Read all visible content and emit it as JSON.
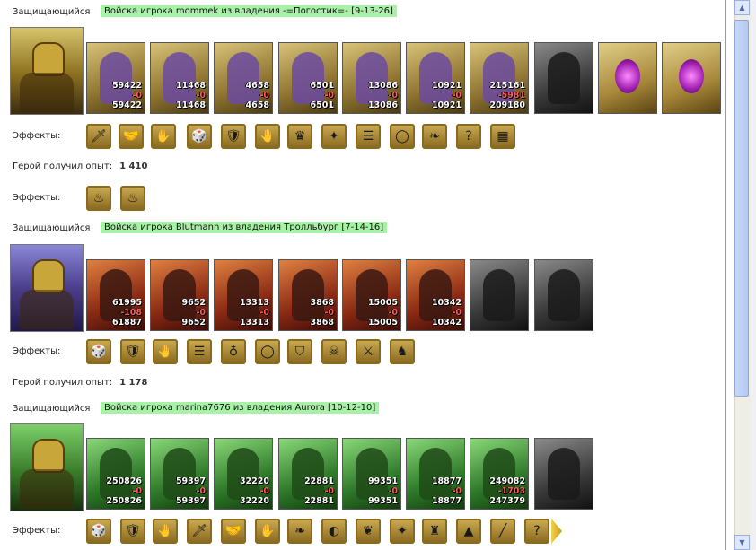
{
  "common": {
    "defender_label": "Защищающийся",
    "effects_label": "Эффекты:",
    "exp_label": "Герой получил опыт:"
  },
  "armies": [
    {
      "title": "Войска игрока mommek из владения -=Погостик=- [9-13-26]",
      "hero_style": "gold",
      "units": [
        {
          "bg": "gold",
          "count": "59422",
          "loss": "-0",
          "remain": "59422"
        },
        {
          "bg": "gold",
          "count": "11468",
          "loss": "-0",
          "remain": "11468"
        },
        {
          "bg": "gold",
          "count": "4658",
          "loss": "-0",
          "remain": "4658"
        },
        {
          "bg": "gold",
          "count": "6501",
          "loss": "-0",
          "remain": "6501"
        },
        {
          "bg": "gold",
          "count": "13086",
          "loss": "-0",
          "remain": "13086"
        },
        {
          "bg": "gold",
          "count": "10921",
          "loss": "-0",
          "remain": "10921"
        },
        {
          "bg": "gold",
          "count": "215161",
          "loss": "-5981",
          "remain": "209180"
        },
        {
          "bg": "gray",
          "count": "",
          "loss": "",
          "remain": ""
        },
        {
          "bg": "gold-orb",
          "count": "",
          "loss": "",
          "remain": ""
        },
        {
          "bg": "gold-orb",
          "count": "",
          "loss": "",
          "remain": ""
        }
      ],
      "effects": [
        {
          "icon": "sword-icon",
          "glyph": "🗡"
        },
        {
          "icon": "handshake-icon",
          "glyph": "🤝"
        },
        {
          "icon": "hand-icon",
          "glyph": "✋"
        },
        {
          "icon": "dice-icon",
          "glyph": "🎲"
        },
        {
          "icon": "shield-icon",
          "glyph": "🛡"
        },
        {
          "icon": "shield-hand-icon",
          "glyph": "🤚"
        },
        {
          "icon": "crown-icon",
          "glyph": "♛"
        },
        {
          "icon": "pentagram-icon",
          "glyph": "✦"
        },
        {
          "icon": "barrel-icon",
          "glyph": "☰"
        },
        {
          "icon": "ring-icon",
          "glyph": "◯"
        },
        {
          "icon": "horn-icon",
          "glyph": "❧"
        },
        {
          "icon": "question-icon",
          "glyph": "?"
        },
        {
          "icon": "cage-icon",
          "glyph": "▦"
        }
      ],
      "exp": "1 410",
      "post_effects": [
        {
          "icon": "flask-pink-icon",
          "glyph": "♨"
        },
        {
          "icon": "flask-green-icon",
          "glyph": "♨"
        }
      ]
    },
    {
      "title": "Войска игрока Blutmann из владения Тролльбург [7-14-16]",
      "hero_style": "purple",
      "units": [
        {
          "bg": "red",
          "count": "61995",
          "loss": "-108",
          "remain": "61887"
        },
        {
          "bg": "red",
          "count": "9652",
          "loss": "-0",
          "remain": "9652"
        },
        {
          "bg": "red",
          "count": "13313",
          "loss": "-0",
          "remain": "13313"
        },
        {
          "bg": "red",
          "count": "3868",
          "loss": "-0",
          "remain": "3868"
        },
        {
          "bg": "red",
          "count": "15005",
          "loss": "-0",
          "remain": "15005"
        },
        {
          "bg": "red",
          "count": "10342",
          "loss": "-0",
          "remain": "10342"
        },
        {
          "bg": "gray",
          "count": "",
          "loss": "",
          "remain": ""
        },
        {
          "bg": "gray",
          "count": "",
          "loss": "",
          "remain": ""
        }
      ],
      "effects": [
        {
          "icon": "dice-icon",
          "glyph": "🎲"
        },
        {
          "icon": "shield-icon",
          "glyph": "🛡"
        },
        {
          "icon": "shield-hand-icon",
          "glyph": "🤚"
        },
        {
          "icon": "barrel-icon",
          "glyph": "☰"
        },
        {
          "icon": "pendant-icon",
          "glyph": "♁"
        },
        {
          "icon": "ring-icon",
          "glyph": "◯"
        },
        {
          "icon": "shield-blue-icon",
          "glyph": "⛉"
        },
        {
          "icon": "skeleton-icon",
          "glyph": "☠"
        },
        {
          "icon": "swords-icon",
          "glyph": "⚔"
        },
        {
          "icon": "horse-icon",
          "glyph": "♞"
        }
      ],
      "exp": "1 178",
      "post_effects": []
    },
    {
      "title": "Войска игрока marina7676 из владения Aurora [10-12-10]",
      "hero_style": "green",
      "units": [
        {
          "bg": "green",
          "count": "250826",
          "loss": "-0",
          "remain": "250826"
        },
        {
          "bg": "green",
          "count": "59397",
          "loss": "-0",
          "remain": "59397"
        },
        {
          "bg": "green",
          "count": "32220",
          "loss": "-0",
          "remain": "32220"
        },
        {
          "bg": "green",
          "count": "22881",
          "loss": "-0",
          "remain": "22881"
        },
        {
          "bg": "green",
          "count": "99351",
          "loss": "-0",
          "remain": "99351"
        },
        {
          "bg": "green",
          "count": "18877",
          "loss": "-0",
          "remain": "18877"
        },
        {
          "bg": "green",
          "count": "249082",
          "loss": "-1703",
          "remain": "247379"
        },
        {
          "bg": "gray",
          "count": "",
          "loss": "",
          "remain": ""
        }
      ],
      "effects": [
        {
          "icon": "dice-icon",
          "glyph": "🎲"
        },
        {
          "icon": "shield-icon",
          "glyph": "🛡"
        },
        {
          "icon": "shield-hand-icon",
          "glyph": "🤚"
        },
        {
          "icon": "sword-icon",
          "glyph": "🗡"
        },
        {
          "icon": "handshake-icon",
          "glyph": "🤝"
        },
        {
          "icon": "hand-icon",
          "glyph": "✋"
        },
        {
          "icon": "horn-icon",
          "glyph": "❧"
        },
        {
          "icon": "mask-icon",
          "glyph": "◐"
        },
        {
          "icon": "wing-icon",
          "glyph": "❦"
        },
        {
          "icon": "pentagram-icon",
          "glyph": "✦"
        },
        {
          "icon": "armor-icon",
          "glyph": "♜"
        },
        {
          "icon": "tent-icon",
          "glyph": "▲"
        },
        {
          "icon": "spear-icon",
          "glyph": "╱"
        },
        {
          "icon": "question-icon",
          "glyph": "?"
        }
      ],
      "exp": "",
      "post_effects": []
    }
  ]
}
